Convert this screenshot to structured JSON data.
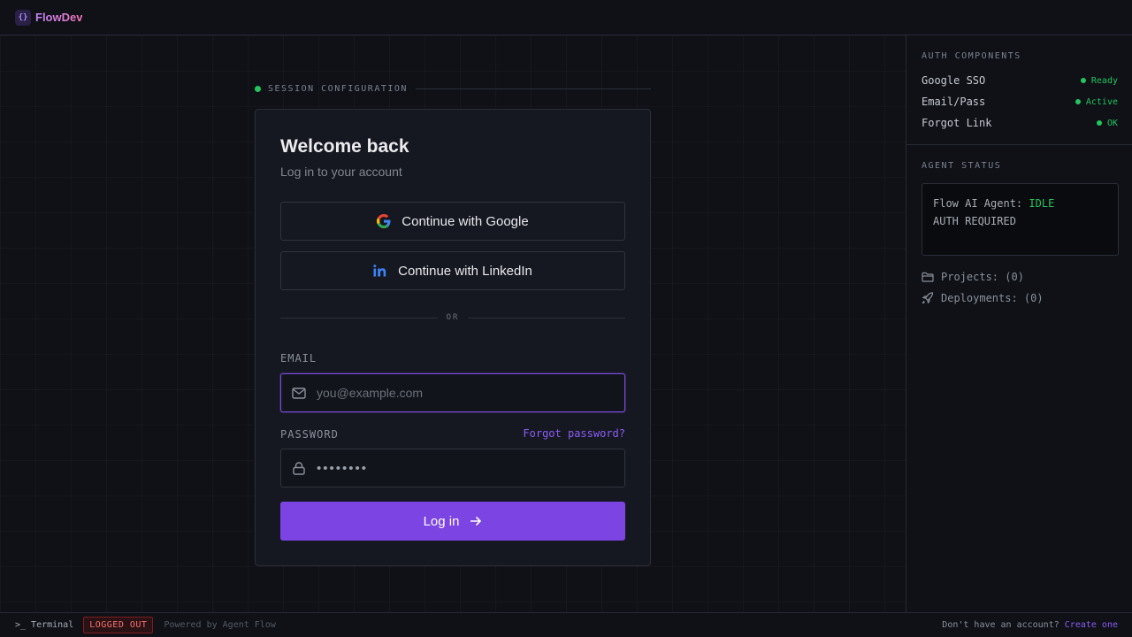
{
  "app": {
    "name": "FlowDev",
    "logo_glyph": "{}"
  },
  "session": {
    "label": "SESSION CONFIGURATION"
  },
  "login": {
    "title": "Welcome back",
    "subtitle": "Log in to your account",
    "google_label": "Continue with Google",
    "linkedin_label": "Continue with LinkedIn",
    "divider": "OR",
    "email_label": "EMAIL",
    "email_placeholder": "you@example.com",
    "email_value": "",
    "password_label": "PASSWORD",
    "password_value": "********",
    "forgot_label": "Forgot password?",
    "submit_label": "Log in"
  },
  "side": {
    "auth_title": "AUTH COMPONENTS",
    "components": [
      {
        "name": "Google SSO",
        "status": "Ready"
      },
      {
        "name": "Email/Pass",
        "status": "Active"
      },
      {
        "name": "Forgot Link",
        "status": "OK"
      }
    ],
    "agent_title": "AGENT STATUS",
    "agent_prefix": "Flow AI Agent:",
    "agent_state": "IDLE",
    "agent_line2": "AUTH REQUIRED",
    "projects": "Projects: (0)",
    "deployments": "Deployments: (0)"
  },
  "footer": {
    "terminal_glyph": ">_",
    "terminal_label": "Terminal",
    "badge": "LOGGED OUT",
    "powered": "Powered by Agent Flow",
    "signup_prompt": "Don't have an account?",
    "signup_link": "Create one"
  },
  "colors": {
    "accent": "#7c44e2",
    "success": "#22c55e",
    "danger": "#f87171",
    "background": "#0f1117"
  },
  "icons": {
    "google": "google-icon",
    "linkedin": "linkedin-icon",
    "email": "mail-icon",
    "password": "lock-icon",
    "submit": "arrow-right-icon",
    "projects": "folder-icon",
    "deployments": "rocket-icon"
  }
}
